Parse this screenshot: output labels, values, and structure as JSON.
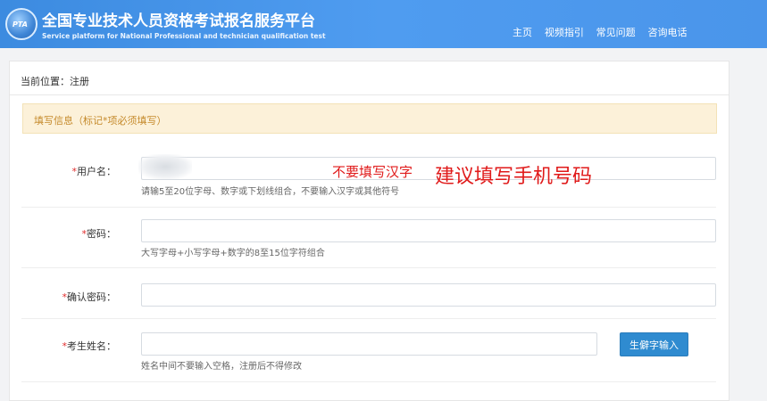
{
  "header": {
    "logo_text": "PTA",
    "title": "全国专业技术人员资格考试报名服务平台",
    "subtitle": "Service platform for National Professional and technician qualification test",
    "nav": [
      "主页",
      "视频指引",
      "常见问题",
      "咨询电话"
    ]
  },
  "breadcrumb": "当前位置：注册",
  "notice": "填写信息（标记*项必须填写）",
  "form": {
    "username": {
      "star": "*",
      "label": "用户名：",
      "hint": "请输5至20位字母、数字或下划线组合，不要输入汉字或其他符号"
    },
    "password": {
      "star": "*",
      "label": "密码：",
      "hint": "大写字母+小写字母+数字的8至15位字符组合"
    },
    "confirm_password": {
      "star": "*",
      "label": "确认密码："
    },
    "candidate_name": {
      "star": "*",
      "label": "考生姓名：",
      "hint": "姓名中间不要输入空格，注册后不得修改",
      "rare_char_button": "生僻字输入"
    }
  },
  "annotations": {
    "small": "不要填写汉字",
    "large": "建议填写手机号码",
    "color": "#e01a1a"
  },
  "colors": {
    "header": "#4a95ea",
    "button": "#2f8bd0",
    "notice_bg": "#fcf1d9",
    "required_star": "#e02b2b"
  }
}
